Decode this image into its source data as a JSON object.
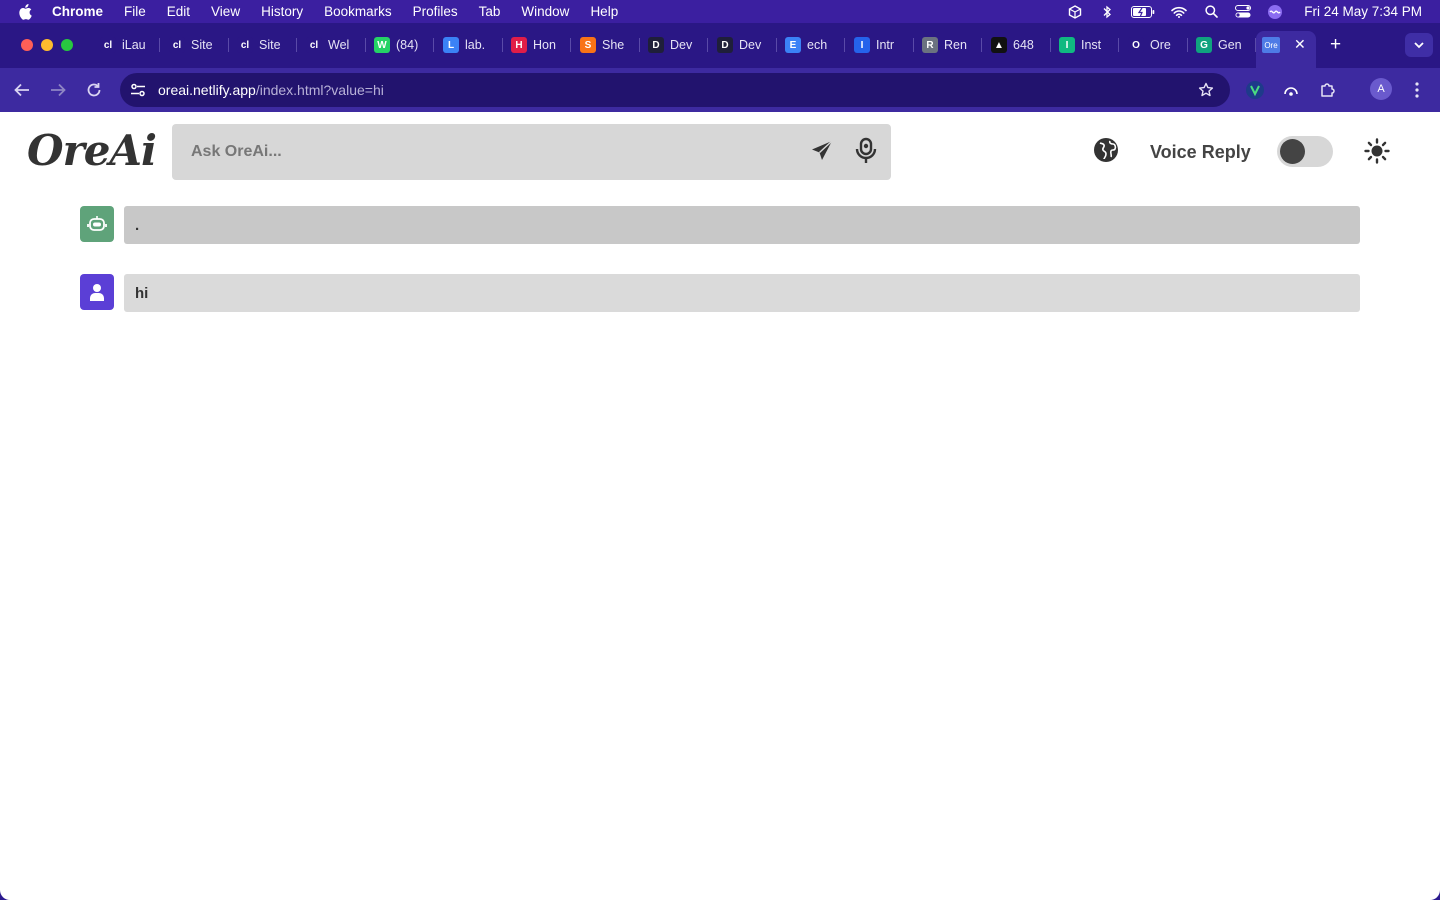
{
  "menubar": {
    "items": [
      "Chrome",
      "File",
      "Edit",
      "View",
      "History",
      "Bookmarks",
      "Profiles",
      "Tab",
      "Window",
      "Help"
    ],
    "clock": "Fri 24 May  7:34 PM"
  },
  "tabs": [
    {
      "label": "iLau",
      "favicon": "cl",
      "color": "#2a1785"
    },
    {
      "label": "Site",
      "favicon": "cl",
      "color": "#2a1785"
    },
    {
      "label": "Site",
      "favicon": "cl",
      "color": "#2a1785"
    },
    {
      "label": "Wel",
      "favicon": "cl",
      "color": "#2a1785"
    },
    {
      "label": "(84)",
      "favicon": "W",
      "color": "#25d366"
    },
    {
      "label": "lab.",
      "favicon": "L",
      "color": "#3b82f6"
    },
    {
      "label": "Hon",
      "favicon": "H",
      "color": "#e11d48"
    },
    {
      "label": "She",
      "favicon": "S",
      "color": "#f97316"
    },
    {
      "label": "Dev",
      "favicon": "D",
      "color": "#1f1f3a"
    },
    {
      "label": "Dev",
      "favicon": "D",
      "color": "#1f1f3a"
    },
    {
      "label": "ech",
      "favicon": "E",
      "color": "#3b82f6"
    },
    {
      "label": "Intr",
      "favicon": "I",
      "color": "#2563eb"
    },
    {
      "label": "Ren",
      "favicon": "R",
      "color": "#6b7280"
    },
    {
      "label": "648",
      "favicon": "▲",
      "color": "#111111"
    },
    {
      "label": "Inst",
      "favicon": "I",
      "color": "#10b981"
    },
    {
      "label": "Ore",
      "favicon": "O",
      "color": "#2a1785"
    },
    {
      "label": "Gen",
      "favicon": "G",
      "color": "#10a37f"
    }
  ],
  "active_tab": {
    "favicon": "Ore"
  },
  "omnibox": {
    "host": "oreai.netlify.app",
    "path": "/index.html?value=hi"
  },
  "profile_initial": "A",
  "app": {
    "logo": "OreAi",
    "search_placeholder": "Ask OreAi...",
    "voice_reply_label": "Voice Reply",
    "voice_reply_on": false
  },
  "messages": [
    {
      "role": "bot",
      "text": ".",
      "avatar_color": "#5fa37a",
      "bubble_color": "#c8c8c8"
    },
    {
      "role": "user",
      "text": "hi",
      "avatar_color": "#5b3fd6",
      "bubble_color": "#dadada"
    }
  ]
}
